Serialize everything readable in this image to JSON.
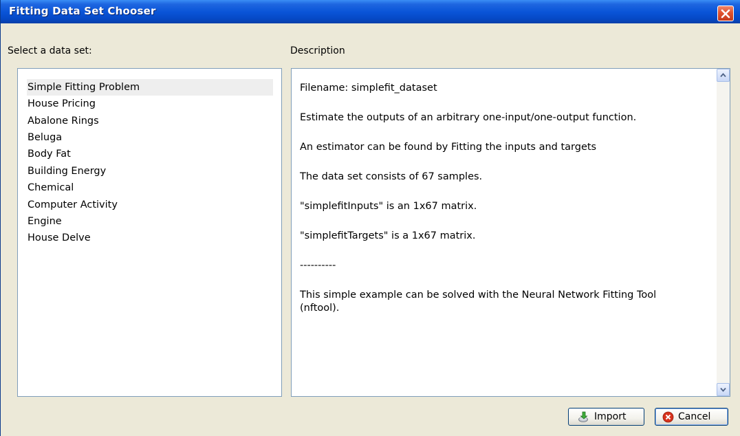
{
  "window": {
    "title": "Fitting Data Set Chooser"
  },
  "left_panel": {
    "label": "Select a data set:",
    "items": [
      {
        "label": "Simple Fitting Problem",
        "selected": true
      },
      {
        "label": "House Pricing"
      },
      {
        "label": "Abalone Rings"
      },
      {
        "label": "Beluga"
      },
      {
        "label": "Body Fat"
      },
      {
        "label": "Building Energy"
      },
      {
        "label": "Chemical"
      },
      {
        "label": "Computer Activity"
      },
      {
        "label": "Engine"
      },
      {
        "label": "House Delve"
      }
    ]
  },
  "right_panel": {
    "label": "Description",
    "lines": [
      "Filename: simplefit_dataset",
      "Estimate the outputs of an arbitrary one-input/one-output function.",
      "An estimator can be found by Fitting the inputs and targets",
      "The data set consists of 67 samples.",
      "\"simplefitInputs\" is an 1x67 matrix.",
      "\"simplefitTargets\" is a 1x67 matrix.",
      "----------",
      "This simple example can be solved with the Neural Network Fitting Tool",
      "(nftool)."
    ]
  },
  "buttons": {
    "import_label": "Import",
    "cancel_label": "Cancel"
  },
  "icons": {
    "close": "close-icon",
    "import": "import-icon",
    "cancel": "cancel-icon",
    "scroll_up": "scroll-up-arrow-icon",
    "scroll_down": "scroll-down-arrow-icon"
  },
  "colors": {
    "titlebar": "#0a55d8",
    "close_button": "#e0522f",
    "selection": "#eeeeee",
    "dialog_bg": "#ece9d8"
  }
}
